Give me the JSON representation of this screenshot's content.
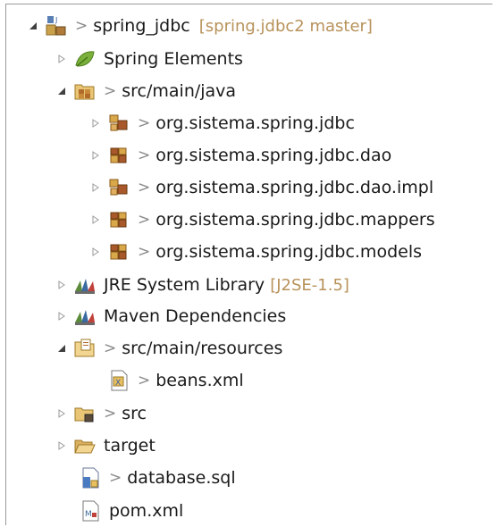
{
  "tree": {
    "project": {
      "name": "spring_jdbc",
      "decoration": "[spring.jdbc2 master]"
    },
    "spring_elements": {
      "label": "Spring Elements"
    },
    "src_main_java": {
      "label": "src/main/java"
    },
    "packages": [
      {
        "label": "org.sistema.spring.jdbc"
      },
      {
        "label": "org.sistema.spring.jdbc.dao"
      },
      {
        "label": "org.sistema.spring.jdbc.dao.impl"
      },
      {
        "label": "org.sistema.spring.jdbc.mappers"
      },
      {
        "label": "org.sistema.spring.jdbc.models"
      }
    ],
    "jre": {
      "label": "JRE System Library",
      "decoration": "[J2SE-1.5]"
    },
    "maven": {
      "label": "Maven Dependencies"
    },
    "src_main_resources": {
      "label": "src/main/resources"
    },
    "beans": {
      "label": "beans.xml"
    },
    "src": {
      "label": "src"
    },
    "target": {
      "label": "target"
    },
    "database": {
      "label": "database.sql"
    },
    "pom": {
      "label": "pom.xml"
    },
    "git_dirty_marker": ">"
  },
  "icons": {
    "project": "java-project-icon",
    "spring": "spring-leaf-icon",
    "source_folder": "source-folder-icon",
    "package": "package-icon",
    "library": "library-jar-icon",
    "folder": "folder-icon",
    "xml": "xml-file-icon",
    "sql": "sql-file-icon"
  },
  "colors": {
    "decoration": "#b8925a",
    "text": "#1a1a1a",
    "git_marker": "#8a8a8a"
  }
}
